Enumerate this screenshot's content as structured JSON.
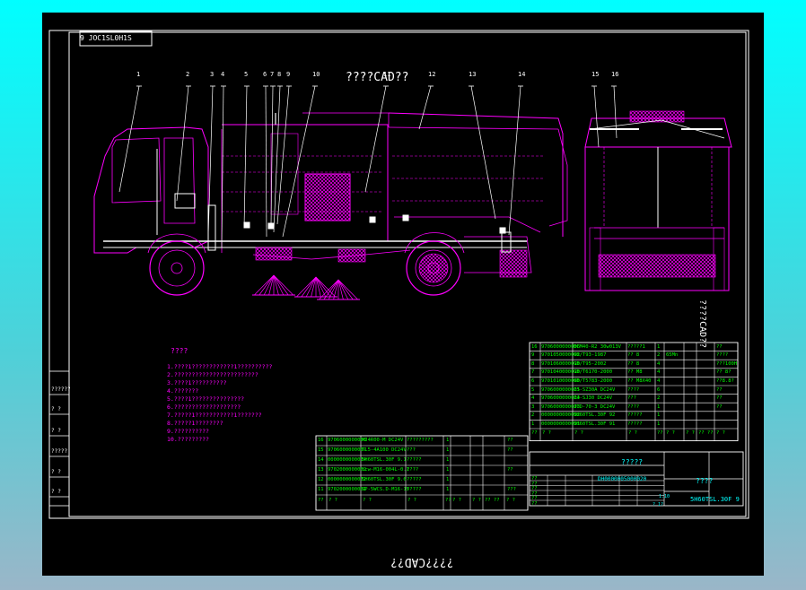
{
  "drawing": {
    "sheet_code_topleft": "9 JOC1SL0H1S",
    "watermark_top": "????CAD??",
    "watermark_right": "????CAD??",
    "watermark_bottom": "????CAD??",
    "notes_title": "????",
    "notes": [
      "1.????1????????????1??????????",
      "2.????????????????????????",
      "3.????1??????????",
      "4.???????",
      "5.????1???????????????",
      "6.???????????????????",
      "7.?????1???????????1???????",
      "8.?????1????????",
      "9.??????????",
      "10.?????????"
    ],
    "callouts": [
      "1",
      "2",
      "3",
      "4",
      "5",
      "6",
      "7",
      "8",
      "9",
      "10",
      "11",
      "12",
      "13",
      "14",
      "15",
      "16"
    ],
    "left_strip": [
      "??????",
      "? ?",
      "? ?",
      "?????",
      "? ?",
      "? ?"
    ],
    "bom_right": [
      {
        "no": "16",
        "code": "9706000000006",
        "spec": "BCM40-R2 30w013V",
        "name": "?????1",
        "qty": "1",
        "mat": "",
        "wt": "",
        "rem": "??"
      },
      {
        "no": "9",
        "code": "9701050000002",
        "spec": "GB/T93-1987",
        "name": "?? 8",
        "qty": "2",
        "mat": "65Mn",
        "wt": "",
        "rem": "????"
      },
      {
        "no": "8",
        "code": "9701060000010",
        "spec": "GB/T95-2002",
        "name": "?? 8",
        "qty": "4",
        "mat": "",
        "wt": "",
        "rem": "???100H"
      },
      {
        "no": "7",
        "code": "9701040000010",
        "spec": "GB/T6170-2000",
        "name": "?? M8",
        "qty": "4",
        "mat": "",
        "wt": "",
        "rem": "?? 8?"
      },
      {
        "no": "6",
        "code": "9701010000080",
        "spec": "GB/T5783-2000",
        "name": "?? M8X40",
        "qty": "4",
        "mat": "",
        "wt": "",
        "rem": "??8.8?"
      },
      {
        "no": "5",
        "code": "9706000000005",
        "spec": "ZJ-SZ30A DC24V",
        "name": "????",
        "qty": "6",
        "mat": "",
        "wt": "",
        "rem": "??"
      },
      {
        "no": "4",
        "code": "9706000000004",
        "spec": "ZJ-SJ30 DC24V",
        "name": "???",
        "qty": "2",
        "mat": "",
        "wt": "",
        "rem": "??"
      },
      {
        "no": "3",
        "code": "9706000000003",
        "spec": "JTD-70-3 DC24V",
        "name": "????",
        "qty": "1",
        "mat": "",
        "wt": "",
        "rem": "??"
      },
      {
        "no": "2",
        "code": "0000000000002",
        "spec": "5H60TSL.30F 92",
        "name": "?????",
        "qty": "1",
        "mat": "",
        "wt": "",
        "rem": ""
      },
      {
        "no": "1",
        "code": "0000000000001",
        "spec": "5H60TSL.30F 91",
        "name": "?????",
        "qty": "1",
        "mat": "",
        "wt": "",
        "rem": ""
      }
    ],
    "bom_right_header": [
      "??",
      "?  ?",
      "? ?",
      "? ?",
      "??",
      "? ?",
      "? ?",
      "?? ??",
      "? ?"
    ],
    "bom_left": [
      {
        "no": "16",
        "code": "9706000000008",
        "spec": "MJ4R00-M DC24V",
        "name": "?????????",
        "qty": "1",
        "rem": "??"
      },
      {
        "no": "15",
        "code": "9706000000007",
        "spec": "TL5-4A100 DC24V",
        "name": "???",
        "qty": "1",
        "rem": "??"
      },
      {
        "no": "14",
        "code": "0000000000014",
        "spec": "5H60TSL.30F 9.1",
        "name": "?????",
        "qty": "1",
        "rem": ""
      },
      {
        "no": "13",
        "code": "9702000000002",
        "spec": "tcw-M16-004L-0.1",
        "name": "????",
        "qty": "1",
        "rem": "??"
      },
      {
        "no": "12",
        "code": "0000000000012",
        "spec": "5H60TSL.30F 9.6",
        "name": "?????",
        "qty": "1",
        "rem": ""
      },
      {
        "no": "11",
        "code": "9702000000001",
        "spec": "SP-5WCS.D-M16-15",
        "name": "?????",
        "qty": "1",
        "rem": "???"
      }
    ],
    "bom_left_header": [
      "??",
      "?  ?",
      "? ?",
      "? ?",
      "??",
      "? ?",
      "? ?",
      "?? ??",
      "? ?"
    ],
    "title_block": {
      "drawing_name": "?????",
      "drawing_code": "DH0000005000020",
      "company": "????",
      "drawing_no": "5H60TSL.30F 9",
      "scale": "1:10",
      "sheets": "? 1?",
      "small_rows": [
        "??",
        "??",
        "??",
        "??",
        "??",
        "??"
      ]
    }
  }
}
